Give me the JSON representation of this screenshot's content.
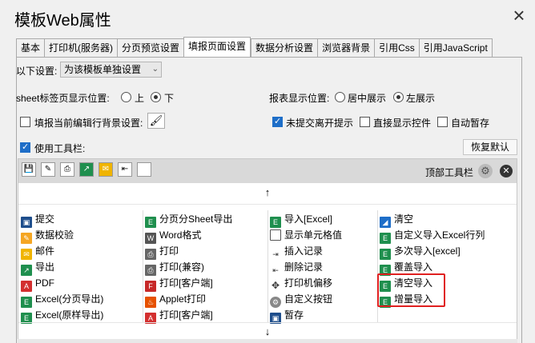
{
  "window": {
    "title": "模板Web属性",
    "close_icon": "×"
  },
  "tabs": [
    {
      "label": "基本"
    },
    {
      "label": "打印机(服务器)"
    },
    {
      "label": "分页预览设置"
    },
    {
      "label": "填报页面设置"
    },
    {
      "label": "数据分析设置"
    },
    {
      "label": "浏览器背景"
    },
    {
      "label": "引用Css"
    },
    {
      "label": "引用JavaScript"
    }
  ],
  "active_tab": "填报页面设置",
  "settings": {
    "mode_label": "以下设置:",
    "mode_value": "为该模板单独设置",
    "sheet_pos_label": "sheet标签页显示位置:",
    "sheet_pos_top": "上",
    "sheet_pos_bottom": "下",
    "report_pos_label": "报表显示位置:",
    "report_pos_center": "居中展示",
    "report_pos_left": "左展示",
    "fill_bg_label": "填报当前编辑行背景设置:",
    "unsubmitted_label": "未提交离开提示",
    "direct_show_label": "直接显示控件",
    "autosave_label": "自动暂存",
    "use_toolbar_label": "使用工具栏:",
    "restore_default": "恢复默认"
  },
  "toolbar": {
    "top_toolbar_label": "顶部工具栏",
    "up_arrow": "↑",
    "down_arrow": "↓",
    "icons": [
      "save-icon",
      "edit-icon",
      "print-icon",
      "export-icon",
      "mail-icon",
      "insert-icon",
      "blank-icon"
    ]
  },
  "buttons": {
    "col1": [
      "提交",
      "数据校验",
      "邮件",
      "导出",
      "PDF",
      "Excel(分页导出)",
      "Excel(原样导出)"
    ],
    "col2": [
      "分页分Sheet导出",
      "Word格式",
      "打印",
      "打印(兼容)",
      "打印[客户端]",
      "Applet打印",
      "打印[客户端]"
    ],
    "col3": [
      "导入[Excel]",
      "显示单元格值",
      "插入记录",
      "删除记录",
      "打印机偏移",
      "自定义按钮",
      "暂存"
    ],
    "col4": [
      "清空",
      "自定义导入Excel行列",
      "多次导入[excel]",
      "覆盖导入",
      "清空导入",
      "增量导入"
    ]
  },
  "colors": {
    "accent": "#1e6ec8",
    "highlight": "#e02020",
    "excel_green": "#1f8f4e",
    "pdf_red": "#d32f2f"
  }
}
